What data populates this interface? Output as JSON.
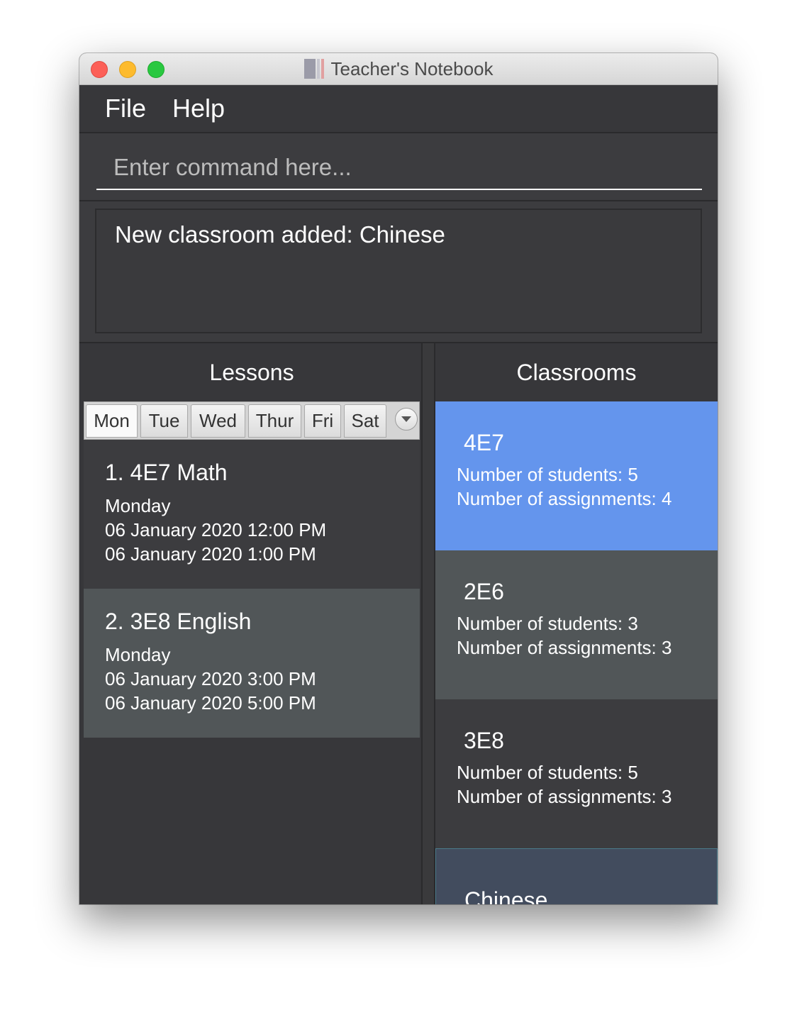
{
  "window": {
    "title": "Teacher's Notebook"
  },
  "menu": {
    "file": "File",
    "help": "Help"
  },
  "command": {
    "placeholder": "Enter command here..."
  },
  "result": {
    "text": "New classroom added: Chinese"
  },
  "lessons": {
    "header": "Lessons",
    "tabs": [
      "Mon",
      "Tue",
      "Wed",
      "Thur",
      "Fri",
      "Sat"
    ],
    "items": [
      {
        "name": "1.  4E7 Math",
        "day": "Monday",
        "start": "06 January 2020 12:00 PM",
        "end": "06 January 2020 1:00 PM"
      },
      {
        "name": "2.  3E8 English",
        "day": "Monday",
        "start": "06 January 2020 3:00 PM",
        "end": "06 January 2020 5:00 PM"
      }
    ]
  },
  "classrooms": {
    "header": "Classrooms",
    "items": [
      {
        "name": "4E7",
        "students": "Number of students: 5",
        "assignments": "Number of assignments: 4"
      },
      {
        "name": "2E6",
        "students": "Number of students: 3",
        "assignments": "Number of assignments: 3"
      },
      {
        "name": "3E8",
        "students": "Number of students: 5",
        "assignments": "Number of assignments: 3"
      },
      {
        "name": "Chinese"
      }
    ]
  },
  "colors": {
    "selected": "#6495ed",
    "row_alt": "#515658",
    "row_dark": "#3c3c3f",
    "row_last": "#424c5e"
  }
}
